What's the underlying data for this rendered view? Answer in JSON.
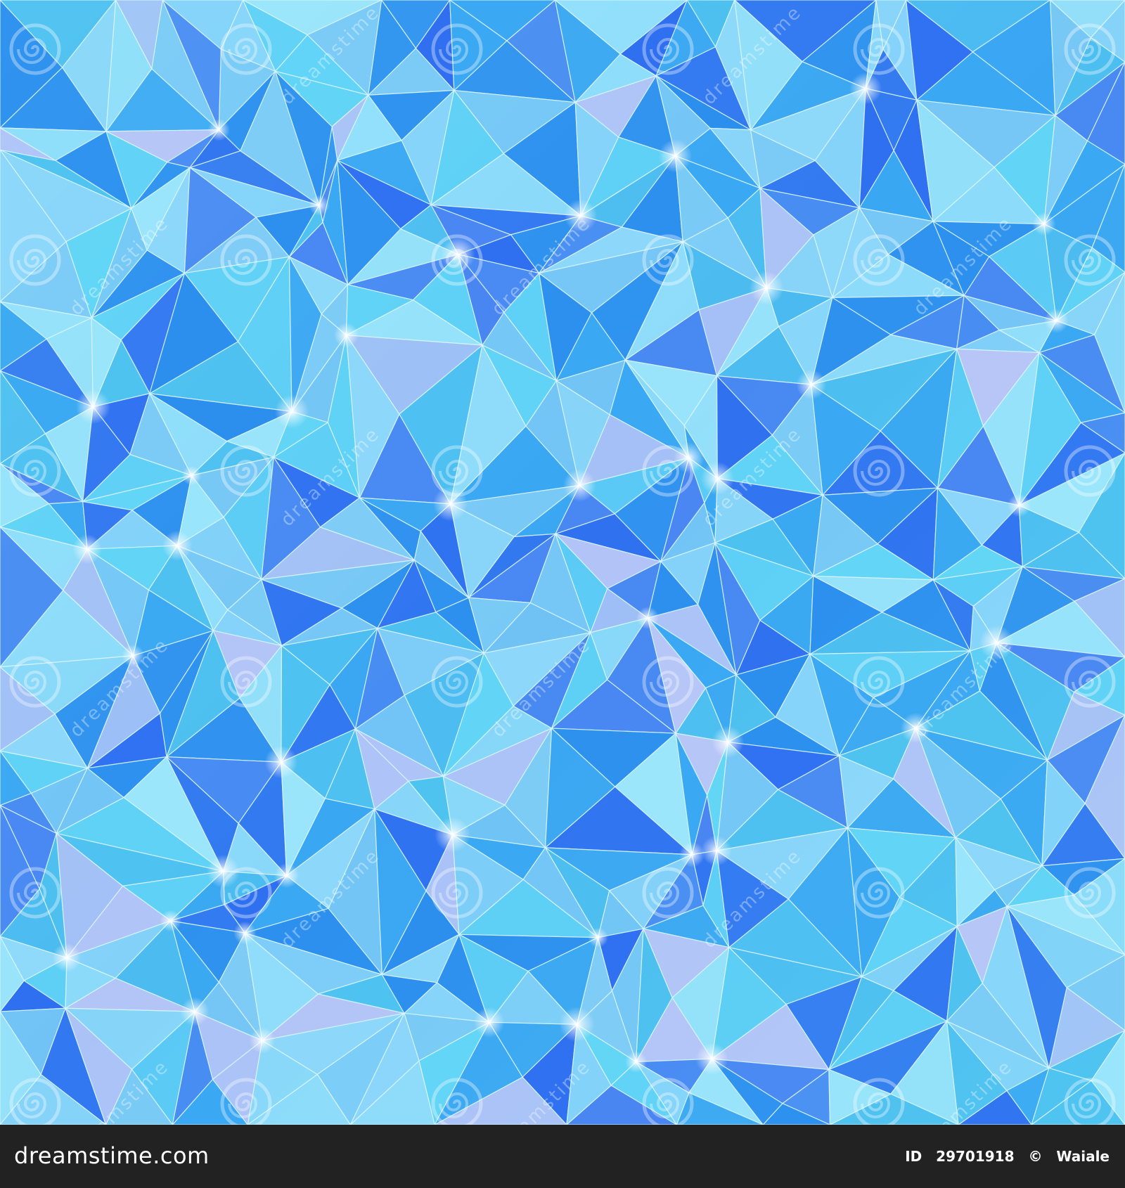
{
  "image": {
    "description_colors": {
      "base": "#4fc3f0",
      "deep": "#2f6ff0",
      "light": "#9ce6fb",
      "lavender": "#b7c6f7",
      "edge": "#d9f6ff"
    },
    "watermark_icon": "swirl-icon",
    "watermark_text": "dreamstime"
  },
  "footer": {
    "brand": "dreamstime.com",
    "id_label": "ID",
    "id_number": "29701918",
    "copyright_symbol": "©",
    "author": "Waiale"
  }
}
